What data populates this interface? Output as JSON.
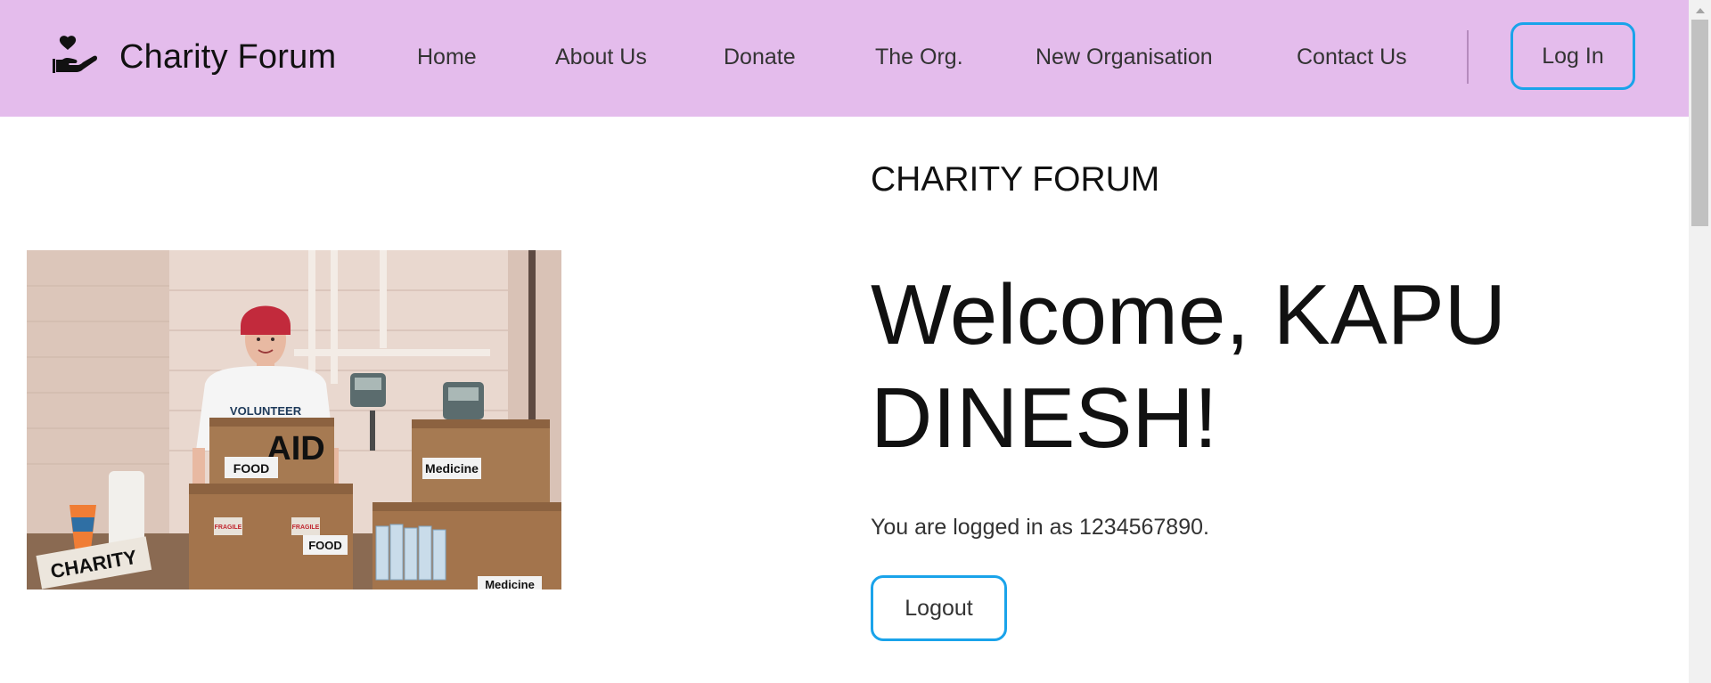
{
  "header": {
    "brand_name": "Charity Forum",
    "brand_icon": "heart-hand-icon",
    "nav": [
      {
        "label": "Home"
      },
      {
        "label": "About Us"
      },
      {
        "label": "Donate"
      },
      {
        "label": "The Org."
      },
      {
        "label": "New Organisation"
      },
      {
        "label": "Contact Us"
      }
    ],
    "login_label": "Log In"
  },
  "hero": {
    "site_title": "CHARITY FORUM",
    "welcome_text": "Welcome, KAPU DINESH!",
    "logged_in_text": "You are logged in as 1234567890.",
    "logout_label": "Logout"
  },
  "photo": {
    "labels": {
      "aid": "AID",
      "food1": "FOOD",
      "food2": "FOOD",
      "medicine1": "Medicine",
      "medicine2": "Medicine",
      "charity": "CHARITY",
      "fragile": "FRAGILE",
      "volunteer": "VOLUNTEER"
    }
  },
  "colors": {
    "header_bg": "#e4bcec",
    "button_border": "#1aa3ea"
  }
}
